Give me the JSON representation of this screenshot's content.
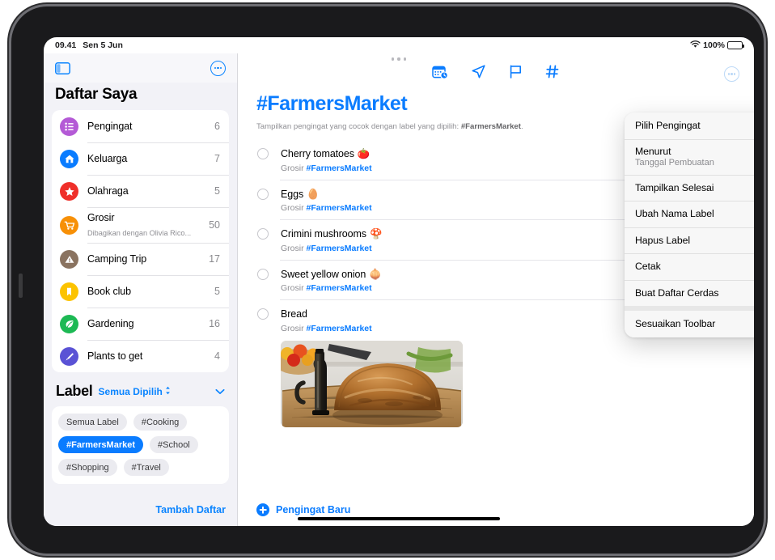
{
  "status_bar": {
    "time": "09.41",
    "date": "Sen 5 Jun",
    "battery_percent": "100%",
    "wifi_icon": "wifi-icon",
    "battery_icon": "battery-icon"
  },
  "sidebar": {
    "toggle_icon": "sidebar-toggle-icon",
    "more_icon": "more-ellipsis-icon",
    "title": "Daftar Saya",
    "lists": [
      {
        "label": "Pengingat",
        "count": "6",
        "icon": "list-bullet-icon",
        "color": "#b45ad6",
        "subtitle": ""
      },
      {
        "label": "Keluarga",
        "count": "7",
        "icon": "house-icon",
        "color": "#0a7cff",
        "subtitle": ""
      },
      {
        "label": "Olahraga",
        "count": "5",
        "icon": "star-icon",
        "color": "#ef2f2a",
        "subtitle": ""
      },
      {
        "label": "Grosir",
        "count": "50",
        "icon": "cart-icon",
        "color": "#f79007",
        "subtitle": "Dibagikan dengan Olivia Rico..."
      },
      {
        "label": "Camping Trip",
        "count": "17",
        "icon": "tent-icon",
        "color": "#8a7360",
        "subtitle": ""
      },
      {
        "label": "Book club",
        "count": "5",
        "icon": "bookmark-icon",
        "color": "#fcc300",
        "subtitle": ""
      },
      {
        "label": "Gardening",
        "count": "16",
        "icon": "leaf-icon",
        "color": "#1db954",
        "subtitle": ""
      },
      {
        "label": "Plants to get",
        "count": "4",
        "icon": "paintbrush-icon",
        "color": "#5a52d5",
        "subtitle": ""
      }
    ],
    "label_section": {
      "heading": "Label",
      "selection": "Semua Dipilih",
      "selection_icon": "up-down-chevron-icon",
      "collapse_icon": "chevron-down-icon",
      "tags": [
        {
          "label": "Semua Label",
          "selected": false
        },
        {
          "label": "#Cooking",
          "selected": false
        },
        {
          "label": "#FarmersMarket",
          "selected": true
        },
        {
          "label": "#School",
          "selected": false
        },
        {
          "label": "#Shopping",
          "selected": false
        },
        {
          "label": "#Travel",
          "selected": false
        }
      ]
    },
    "add_list_label": "Tambah Daftar"
  },
  "detail": {
    "toolbar_icons": [
      "calendar-clock-icon",
      "location-arrow-icon",
      "flag-icon",
      "hashtag-icon"
    ],
    "more_icon": "more-ellipsis-icon",
    "multitask_handle_icon": "multitask-handle-icon",
    "title": "#FarmersMarket",
    "subtitle_prefix": "Tampilkan pengingat yang cocok dengan label yang dipilih: ",
    "subtitle_tag": "#FarmersMarket",
    "subtitle_suffix": ".",
    "reminders": [
      {
        "title": "Cherry tomatoes",
        "emoji": "🍅",
        "list": "Grosir",
        "tag": "#FarmersMarket",
        "photo": false
      },
      {
        "title": "Eggs",
        "emoji": "🥚",
        "list": "Grosir",
        "tag": "#FarmersMarket",
        "photo": false
      },
      {
        "title": "Crimini mushrooms",
        "emoji": "🍄",
        "list": "Grosir",
        "tag": "#FarmersMarket",
        "photo": false
      },
      {
        "title": "Sweet yellow onion",
        "emoji": "🧅",
        "list": "Grosir",
        "tag": "#FarmersMarket",
        "photo": false
      },
      {
        "title": "Bread",
        "emoji": "",
        "list": "Grosir",
        "tag": "#FarmersMarket",
        "photo": true,
        "photo_alt": "bread-loaf-photo"
      }
    ],
    "new_reminder_label": "Pengingat Baru",
    "new_reminder_icon": "plus-circle-icon"
  },
  "context_menu": {
    "items": [
      {
        "title": "Pilih Pengingat",
        "sub": "",
        "icon": "checkmark-circle-icon",
        "chevron": false,
        "sep_after": false
      },
      {
        "title": "Menurut",
        "sub": "Tanggal Pembuatan",
        "icon": "sort-arrows-icon",
        "chevron": true,
        "sep_after": false
      },
      {
        "title": "Tampilkan Selesai",
        "sub": "",
        "icon": "eye-icon",
        "chevron": false,
        "sep_after": false
      },
      {
        "title": "Ubah Nama Label",
        "sub": "",
        "icon": "pencil-icon",
        "chevron": false,
        "sep_after": false
      },
      {
        "title": "Hapus Label",
        "sub": "",
        "icon": "trash-icon",
        "chevron": false,
        "sep_after": false
      },
      {
        "title": "Cetak",
        "sub": "",
        "icon": "printer-icon",
        "chevron": false,
        "sep_after": false
      },
      {
        "title": "Buat Daftar Cerdas",
        "sub": "",
        "icon": "gear-icon",
        "chevron": false,
        "sep_after": true
      },
      {
        "title": "Sesuaikan Toolbar",
        "sub": "",
        "icon": "wrench-icon",
        "chevron": false,
        "sep_after": false
      }
    ]
  },
  "colors": {
    "accent": "#0a7cff",
    "sidebar_bg": "#f2f2f7",
    "selected_tag": "#0a7cff"
  }
}
